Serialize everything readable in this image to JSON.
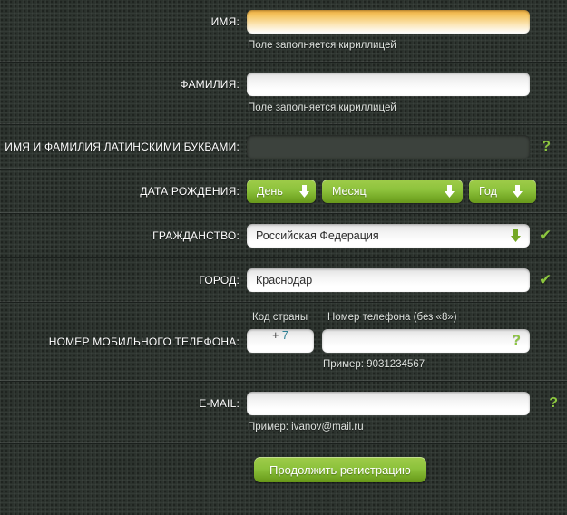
{
  "fields": {
    "first_name": {
      "label": "ИМЯ:",
      "value": "",
      "hint": "Поле заполняется кириллицей"
    },
    "last_name": {
      "label": "ФАМИЛИЯ:",
      "value": "",
      "hint": "Поле заполняется кириллицей"
    },
    "latin_name": {
      "label": "ИМЯ И ФАМИЛИЯ ЛАТИНСКИМИ БУКВАМИ:",
      "value": "",
      "help_icon": "?"
    },
    "birth_date": {
      "label": "ДАТА РОЖДЕНИЯ:",
      "day": "День",
      "month": "Месяц",
      "year": "Год",
      "arrow_icon": "arrow-down-icon"
    },
    "citizenship": {
      "label": "ГРАЖДАНСТВО:",
      "value": "Российская Федерация",
      "arrow_icon": "arrow-down-icon",
      "valid_icon": "✔"
    },
    "city": {
      "label": "ГОРОД:",
      "value": "Краснодар",
      "valid_icon": "✔"
    },
    "phone": {
      "label": "НОМЕР МОБИЛЬНОГО ТЕЛЕФОНА:",
      "code_sublabel": "Код страны",
      "number_sublabel": "Номер телефона (без «8»)",
      "code_plus": "+",
      "code_value": "7",
      "number_value": "",
      "help_icon": "?",
      "hint": "Пример: 9031234567"
    },
    "email": {
      "label": "E-MAIL:",
      "value": "",
      "help_icon": "?",
      "hint": "Пример: ivanov@mail.ru"
    }
  },
  "submit": {
    "label": "Продолжить регистрацию"
  },
  "colors": {
    "background": "#2c332e",
    "accent_green": "#8cc63f",
    "button_green_top": "#9fcc4a",
    "button_green_bottom": "#69991c",
    "focus_amber": "#efae3e",
    "label_text": "#ffffff",
    "hint_text": "#dfe3df",
    "phone_code_digit": "#2c7f93"
  }
}
